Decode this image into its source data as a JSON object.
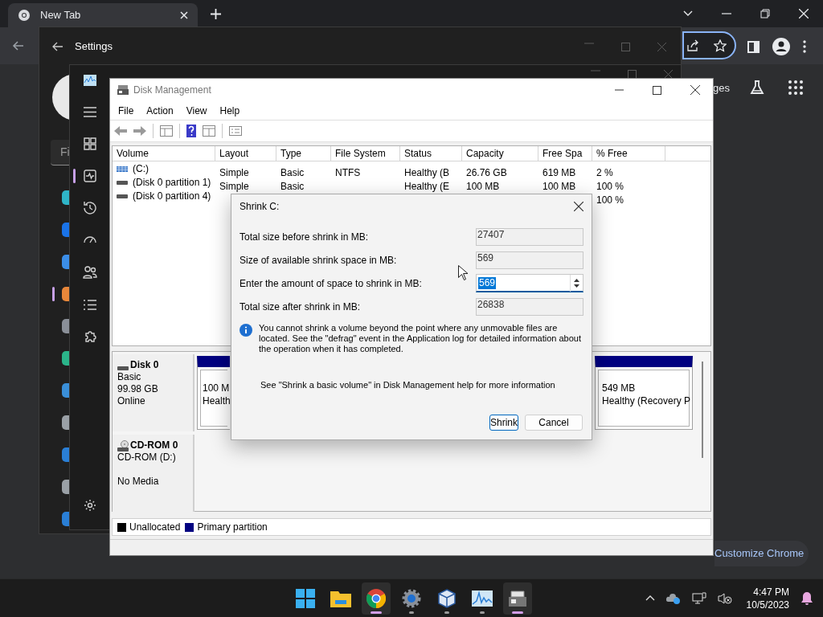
{
  "browser": {
    "tabs": [
      {
        "label": "New Tab",
        "selected": true
      }
    ],
    "link_partial": "ges",
    "customize_button": "Customize Chrome"
  },
  "settings_window": {
    "title": "Settings",
    "search_partial": "Fi",
    "nav": [
      {
        "kind": "system",
        "selected": false
      },
      {
        "kind": "bluetooth",
        "selected": false
      },
      {
        "kind": "network",
        "selected": false
      },
      {
        "kind": "personalization",
        "selected": true
      },
      {
        "kind": "apps",
        "selected": false
      },
      {
        "kind": "accounts",
        "selected": false
      },
      {
        "kind": "time",
        "selected": false
      },
      {
        "kind": "gaming",
        "selected": false
      },
      {
        "kind": "accessibility",
        "selected": false
      },
      {
        "kind": "privacy",
        "selected": false
      },
      {
        "kind": "update",
        "selected": false
      }
    ]
  },
  "task_manager": {
    "nav": [
      {
        "kind": "menu",
        "selected": false
      },
      {
        "kind": "processes",
        "selected": false
      },
      {
        "kind": "performance",
        "selected": true
      },
      {
        "kind": "history",
        "selected": false
      },
      {
        "kind": "startup",
        "selected": false
      },
      {
        "kind": "users",
        "selected": false
      },
      {
        "kind": "details",
        "selected": false
      },
      {
        "kind": "services",
        "selected": false
      },
      {
        "kind": "settings",
        "selected": false
      }
    ]
  },
  "disk_management": {
    "title": "Disk Management",
    "menu": [
      "File",
      "Action",
      "View",
      "Help"
    ],
    "columns": [
      "Volume",
      "Layout",
      "Type",
      "File System",
      "Status",
      "Capacity",
      "Free Spa",
      "% Free"
    ],
    "rows": [
      {
        "kind": "striped",
        "volume": "(C:)",
        "layout": "Simple",
        "type": "Basic",
        "file_system": "NTFS",
        "status": "Healthy (B",
        "capacity": "26.76 GB",
        "free_space": "619 MB",
        "pct_free": "2 %"
      },
      {
        "kind": "plain",
        "volume": "(Disk 0 partition 1)",
        "layout": "Simple",
        "type": "Basic",
        "status": "Healthy (E",
        "capacity": "100 MB",
        "free_space": "100 MB",
        "pct_free": "100 %"
      },
      {
        "kind": "plain",
        "volume": "(Disk 0 partition 4)",
        "pct_free": "100 %"
      }
    ],
    "disks": [
      {
        "kind": "disk",
        "name": "Disk 0",
        "lines": [
          "Basic",
          "99.98 GB",
          "Online"
        ],
        "partitions": [
          {
            "size": "100 M",
            "status": "Health"
          },
          {
            "size": "549 MB",
            "status": "Healthy (Recovery P"
          }
        ]
      },
      {
        "kind": "cdrom",
        "name": "CD-ROM 0",
        "lines": [
          "CD-ROM (D:)",
          "No Media"
        ]
      }
    ],
    "legend": [
      {
        "label": "Unallocated",
        "color": "#000000"
      },
      {
        "label": "Primary partition",
        "color": "#000080"
      }
    ]
  },
  "dialog": {
    "title": "Shrink C:",
    "fields": [
      {
        "kind": "readonly",
        "label": "Total size before shrink in MB:",
        "value": "27407"
      },
      {
        "kind": "readonly",
        "label": "Size of available shrink space in MB:",
        "value": "569"
      },
      {
        "kind": "spinner",
        "label": "Enter the amount of space to shrink in MB:",
        "value": "569"
      },
      {
        "kind": "readonly",
        "label": "Total size after shrink in MB:",
        "value": "26838"
      }
    ],
    "info": "You cannot shrink a volume beyond the point where any unmovable files are located. See the \"defrag\" event in the Application log for detailed information about the operation when it has completed.",
    "help": "See \"Shrink a basic volume\" in Disk Management help for more information",
    "buttons": [
      {
        "label": "Shrink",
        "default": true
      },
      {
        "label": "Cancel",
        "default": false
      }
    ]
  },
  "taskbar": {
    "apps": [
      {
        "kind": "start",
        "selected": false,
        "running": false
      },
      {
        "kind": "explorer",
        "selected": false,
        "running": false
      },
      {
        "kind": "chrome",
        "selected": true,
        "running": true
      },
      {
        "kind": "settings",
        "selected": false,
        "running": true
      },
      {
        "kind": "virtualbox",
        "selected": false,
        "running": true
      },
      {
        "kind": "perfmon",
        "selected": false,
        "running": true
      },
      {
        "kind": "diskmgmt",
        "selected": true,
        "running": true
      }
    ],
    "time": "4:47 PM",
    "date": "10/5/2023"
  }
}
